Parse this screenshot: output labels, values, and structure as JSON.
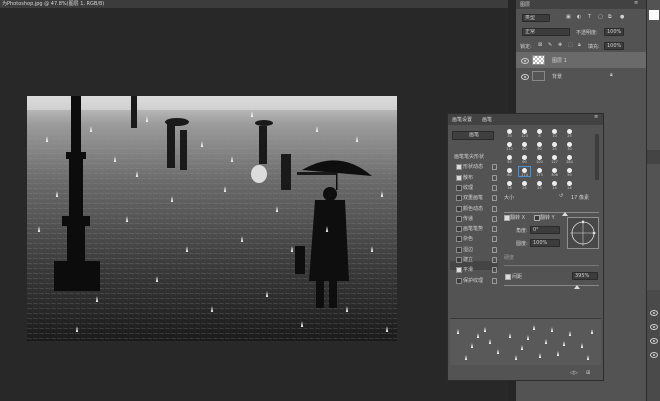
{
  "title_tab": "为Photoshop.jpg @ 47.8%(图层 1, RGB/8)",
  "layers_panel": {
    "tab_label": "图层",
    "kind_filter": "类型",
    "blend_mode": "正常",
    "opacity_label": "不透明度:",
    "opacity_value": "100%",
    "lock_label": "锁定:",
    "fill_label": "填充:",
    "fill_value": "100%",
    "layers": [
      {
        "name": "图层 1"
      },
      {
        "name": "背景"
      }
    ]
  },
  "brush_panel": {
    "tabs": [
      "画笔设置",
      "画笔"
    ],
    "preset_button": "画笔",
    "options": [
      {
        "label": "画笔笔尖形状",
        "checked": false,
        "lock": false
      },
      {
        "label": "形状动态",
        "checked": true,
        "lock": true
      },
      {
        "label": "散布",
        "checked": true,
        "lock": true
      },
      {
        "label": "纹理",
        "checked": false,
        "lock": true
      },
      {
        "label": "双重画笔",
        "checked": false,
        "lock": true
      },
      {
        "label": "颜色动态",
        "checked": false,
        "lock": true
      },
      {
        "label": "传递",
        "checked": false,
        "lock": true
      },
      {
        "label": "画笔笔势",
        "checked": false,
        "lock": true
      },
      {
        "label": "杂色",
        "checked": false,
        "lock": true
      },
      {
        "label": "湿边",
        "checked": false,
        "lock": true
      },
      {
        "label": "建立",
        "checked": false,
        "lock": true
      },
      {
        "label": "平滑",
        "checked": true,
        "lock": true
      },
      {
        "label": "保护纹理",
        "checked": false,
        "lock": true
      }
    ],
    "tip_numbers": [
      "30",
      "123",
      "8",
      "10",
      "25",
      "112",
      "60",
      "50",
      "25",
      "30",
      "50",
      "60",
      "100",
      "127",
      "284",
      "80",
      "174",
      "175",
      "306",
      "50",
      "16",
      "25",
      "25",
      "14",
      "24"
    ],
    "size_label": "大小",
    "size_value": "17 像素",
    "flip_x": "翻转 X",
    "flip_y": "翻转 Y",
    "angle_label": "角度:",
    "angle_value": "0°",
    "roundness_label": "圆度:",
    "roundness_value": "100%",
    "hardness_label": "硬度",
    "spacing_label": "间距",
    "spacing_value": "395%"
  }
}
